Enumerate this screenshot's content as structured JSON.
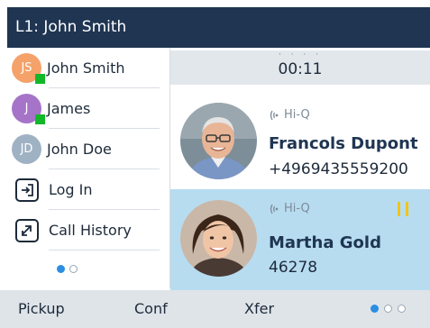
{
  "header": {
    "title": "L1: John Smith"
  },
  "contacts": [
    {
      "initials": "JS",
      "name": "John Smith",
      "color": "#f4a26a",
      "presence": true
    },
    {
      "initials": "J",
      "name": "James",
      "color": "#a574c9",
      "presence": true
    },
    {
      "initials": "JD",
      "name": "John Doe",
      "color": "#9fb2c4",
      "presence": false
    }
  ],
  "actions": [
    {
      "icon": "login-icon",
      "label": "Log In"
    },
    {
      "icon": "call-history-icon",
      "label": "Call History"
    }
  ],
  "left_pager": {
    "pages": 2,
    "active": 1
  },
  "timer": {
    "value": "00:11"
  },
  "calls": [
    {
      "codec": "Hi-Q",
      "name": "Francols Dupont",
      "number": "+4969435559200",
      "state": "active"
    },
    {
      "codec": "Hi-Q",
      "name": "Martha Gold",
      "number": "46278",
      "state": "held"
    }
  ],
  "softkeys": {
    "pickup": "Pickup",
    "conf": "Conf",
    "xfer": "Xfer"
  },
  "softkey_pager": {
    "pages": 3,
    "active": 1
  },
  "colors": {
    "header_bg": "#1f3552",
    "held_bg": "#b7dcf0",
    "presence_available": "#12b82a",
    "pause_icon": "#f2c418",
    "pager_active": "#2b8ee3"
  }
}
